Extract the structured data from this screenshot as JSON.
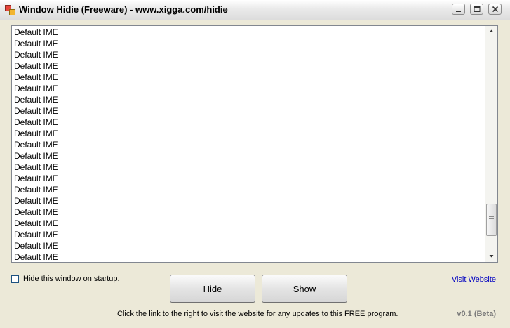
{
  "window": {
    "title": "Window Hidie (Freeware) - www.xigga.com/hidie"
  },
  "list": {
    "items": [
      "Default IME",
      "Default IME",
      "Default IME",
      "Default IME",
      "Default IME",
      "Default IME",
      "Default IME",
      "Default IME",
      "Default IME",
      "Default IME",
      "Default IME",
      "Default IME",
      "Default IME",
      "Default IME",
      "Default IME",
      "Default IME",
      "Default IME",
      "Default IME",
      "Default IME",
      "Default IME",
      "Default IME"
    ],
    "scroll_position": 0.92
  },
  "options": {
    "hide_on_startup_label": "Hide this window on startup.",
    "hide_on_startup_checked": false
  },
  "buttons": {
    "hide_label": "Hide",
    "show_label": "Show"
  },
  "footer": {
    "visit_link": "Visit Website",
    "hint": "Click the link to the right to visit the website for any updates to this FREE program.",
    "version": "v0.1 (Beta)"
  },
  "colors": {
    "background": "#ece9d8",
    "link": "#0000c0",
    "version_text": "#7a7a7a"
  },
  "icons": [
    "app-icon",
    "minimize-icon",
    "maximize-icon",
    "close-icon",
    "scroll-up-icon",
    "scroll-down-icon"
  ]
}
